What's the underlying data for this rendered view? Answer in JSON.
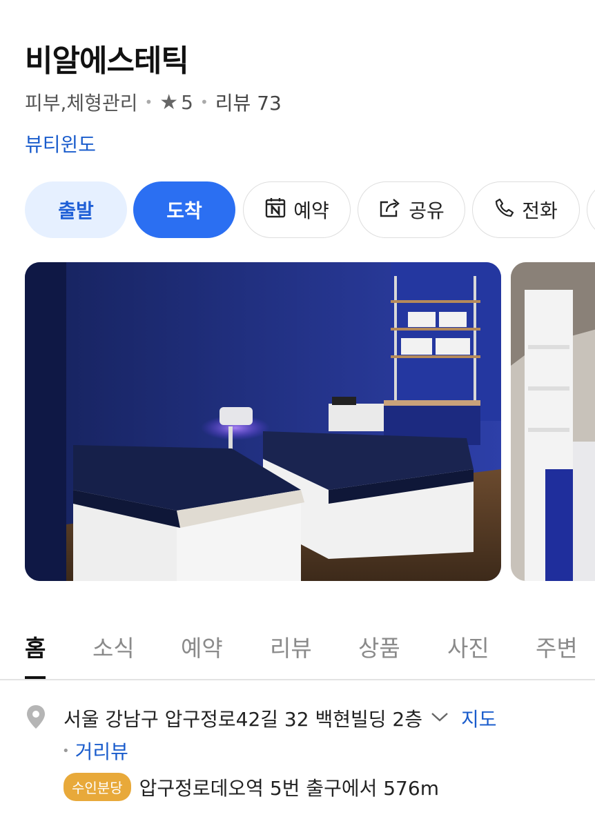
{
  "place": {
    "name": "비알에스테틱",
    "category": "피부,체형관리",
    "rating": "5",
    "reviews_label": "리뷰 73",
    "partner_link": "뷰티윈도"
  },
  "actions": {
    "depart": "출발",
    "arrive": "도착",
    "reserve": "예약",
    "share": "공유",
    "call": "전화"
  },
  "tabs": [
    "홈",
    "소식",
    "예약",
    "리뷰",
    "상품",
    "사진",
    "주변"
  ],
  "active_tab": "홈",
  "info": {
    "address": "서울 강남구 압구정로42길 32 백현빌딩 2층",
    "map_link": "지도",
    "street_view": "거리뷰",
    "station_badge": "수인분당",
    "station_text": "압구정로데오역 5번 출구에서 576m"
  },
  "colors": {
    "accent_blue": "#2b6ff2",
    "link_blue": "#1a5ccc",
    "badge_yellow": "#e8a93a"
  }
}
